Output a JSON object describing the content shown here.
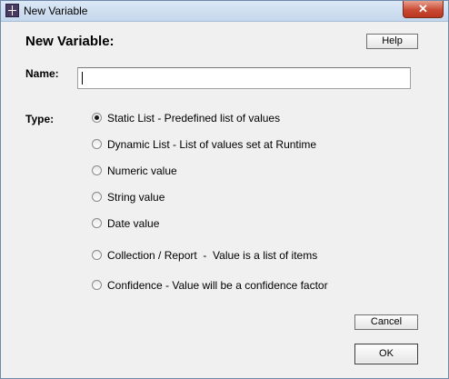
{
  "window": {
    "title": "New Variable",
    "close_symbol": "✕"
  },
  "dialog": {
    "heading": "New Variable:",
    "help_label": "Help",
    "name_label": "Name:",
    "name_value": "",
    "type_label": "Type:",
    "options": [
      {
        "label": "Static List - Predefined list of values",
        "selected": true
      },
      {
        "label": "Dynamic List - List of values set at Runtime",
        "selected": false
      },
      {
        "label": "Numeric value",
        "selected": false
      },
      {
        "label": "String value",
        "selected": false
      },
      {
        "label": "Date value",
        "selected": false
      },
      {
        "label": "Collection / Report  -  Value is a list of items",
        "selected": false
      },
      {
        "label": "Confidence - Value will be a confidence factor",
        "selected": false
      }
    ],
    "cancel_label": "Cancel",
    "ok_label": "OK"
  },
  "icons": {
    "app": "app-icon",
    "close": "close-icon"
  }
}
